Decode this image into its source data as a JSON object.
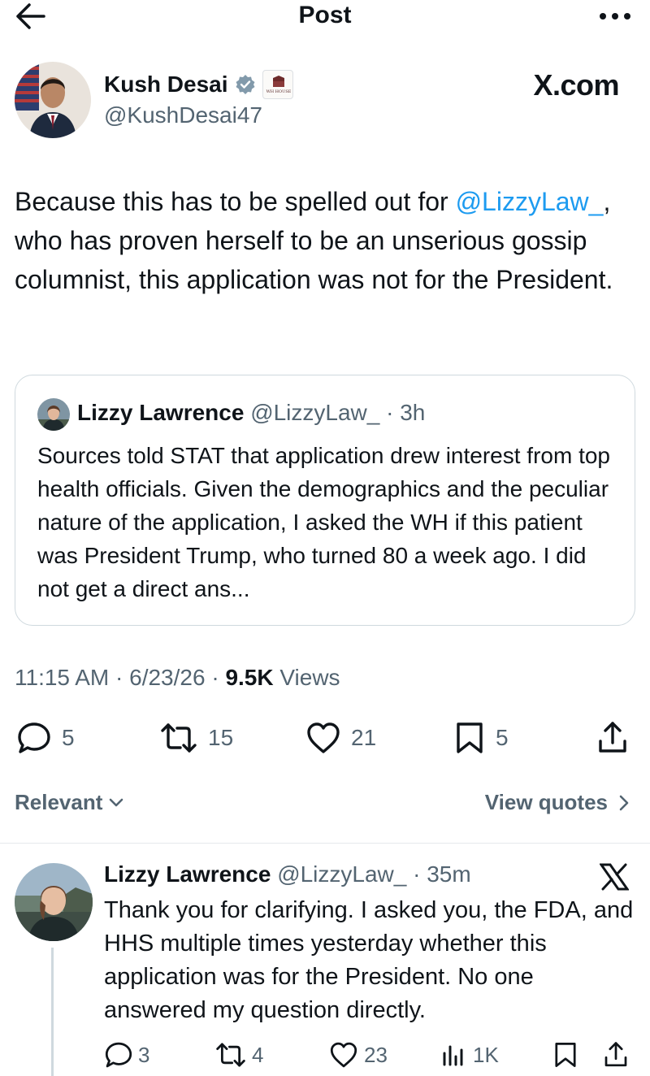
{
  "topbar": {
    "title": "Post"
  },
  "author": {
    "name": "Kush Desai",
    "handle": "@KushDesai47",
    "affiliation_badge_text": "WH HOUSE"
  },
  "watermark": "X.com",
  "post": {
    "text_before": "Because this has to be spelled out for ",
    "mention": "@LizzyLaw_",
    "text_after": ", who has proven herself to be an unserious gossip columnist, this application was not for the President."
  },
  "quote": {
    "name": "Lizzy Lawrence",
    "handle": "@LizzyLaw_",
    "time": " · 3h",
    "text": "Sources told STAT that application drew interest from top health officials. Given the demographics and the peculiar nature of the application, I asked the WH if this patient was President Trump, who turned 80 a week ago. I did not get a direct ans..."
  },
  "meta": {
    "time": "11:15 AM",
    "date": "6/23/26",
    "views_count": "9.5K",
    "views_label": "Views",
    "sep": " · "
  },
  "actions": {
    "replies": "5",
    "reposts": "15",
    "likes": "21",
    "bookmarks": "5"
  },
  "filters": {
    "relevant_label": "Relevant",
    "view_quotes_label": "View quotes"
  },
  "reply": {
    "name": "Lizzy Lawrence",
    "handle": "@LizzyLaw_",
    "time": " · 35m",
    "text": "Thank you for clarifying. I asked you, the FDA, and HHS multiple times yesterday whether this application was for the President. No one answered my question directly.",
    "replies": "3",
    "reposts": "4",
    "likes": "23",
    "views": "1K"
  },
  "colors": {
    "link": "#1d9bf0",
    "secondary_text": "#536471",
    "primary_text": "#0f1419",
    "border": "#cfd9de"
  }
}
